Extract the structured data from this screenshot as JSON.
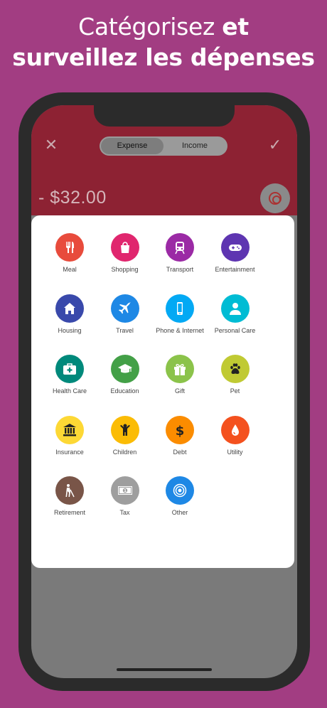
{
  "headline": {
    "line1_regular": "Catégorisez ",
    "line1_bold": "et",
    "line2": "surveillez les dépenses"
  },
  "topbar": {
    "close_icon": "close-icon",
    "check_icon": "check-icon",
    "tabs": [
      {
        "label": "Expense",
        "active": true
      },
      {
        "label": "Income",
        "active": false
      }
    ],
    "amount": "- $32.00",
    "category_icon": "target-icon"
  },
  "categories": [
    {
      "label": "Meal",
      "color": "#e84b3c",
      "icon": "utensils-icon"
    },
    {
      "label": "Shopping",
      "color": "#e0266e",
      "icon": "shopping-bag-icon"
    },
    {
      "label": "Transport",
      "color": "#9b2aa5",
      "icon": "train-icon"
    },
    {
      "label": "Entertainment",
      "color": "#5e35b1",
      "icon": "gamepad-icon"
    },
    {
      "label": "Housing",
      "color": "#3949ab",
      "icon": "house-icon"
    },
    {
      "label": "Travel",
      "color": "#1e88e5",
      "icon": "airplane-icon"
    },
    {
      "label": "Phone & Internet",
      "color": "#03a9f4",
      "icon": "phone-icon"
    },
    {
      "label": "Personal Care",
      "color": "#00bcd4",
      "icon": "person-icon"
    },
    {
      "label": "Health Care",
      "color": "#00897b",
      "icon": "first-aid-icon"
    },
    {
      "label": "Education",
      "color": "#43a047",
      "icon": "graduation-cap-icon"
    },
    {
      "label": "Gift",
      "color": "#8bc34a",
      "icon": "gift-icon"
    },
    {
      "label": "Pet",
      "color": "#c0ca33",
      "icon": "paw-icon"
    },
    {
      "label": "Insurance",
      "color": "#fdd835",
      "icon": "bank-icon"
    },
    {
      "label": "Children",
      "color": "#fbbc05",
      "icon": "child-icon"
    },
    {
      "label": "Debt",
      "color": "#fb8c00",
      "icon": "dollar-icon"
    },
    {
      "label": "Utility",
      "color": "#f4511e",
      "icon": "drop-icon"
    },
    {
      "label": "Retirement",
      "color": "#795548",
      "icon": "elder-icon"
    },
    {
      "label": "Tax",
      "color": "#9e9e9e",
      "icon": "banknote-icon"
    },
    {
      "label": "Other",
      "color": "#1e88e5",
      "icon": "target-icon"
    }
  ]
}
